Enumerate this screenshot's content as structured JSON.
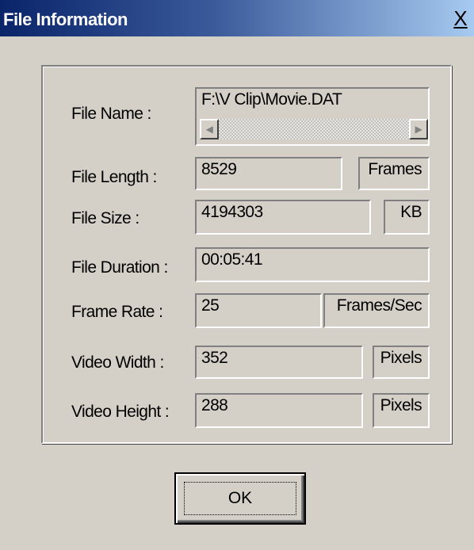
{
  "window": {
    "title": "File Information",
    "close_label": "X"
  },
  "fields": {
    "file_name": {
      "label": "File Name :",
      "value": "F:\\V Clip\\Movie.DAT"
    },
    "file_length": {
      "label": "File Length :",
      "value": "8529",
      "unit": "Frames"
    },
    "file_size": {
      "label": "File Size :",
      "value": "4194303",
      "unit": "KB"
    },
    "file_duration": {
      "label": "File Duration :",
      "value": "00:05:41"
    },
    "frame_rate": {
      "label": "Frame Rate :",
      "value": "25",
      "unit": "Frames/Sec"
    },
    "video_width": {
      "label": "Video Width :",
      "value": "352",
      "unit": "Pixels"
    },
    "video_height": {
      "label": "Video Height :",
      "value": "288",
      "unit": "Pixels"
    }
  },
  "buttons": {
    "ok_label": "OK"
  },
  "icons": {
    "scroll_left": "scroll-left-arrow-icon",
    "scroll_right": "scroll-right-arrow-icon"
  },
  "colors": {
    "dialog_face": "#d4d0c8",
    "title_start": "#0a246a",
    "title_end": "#a6caf0"
  }
}
